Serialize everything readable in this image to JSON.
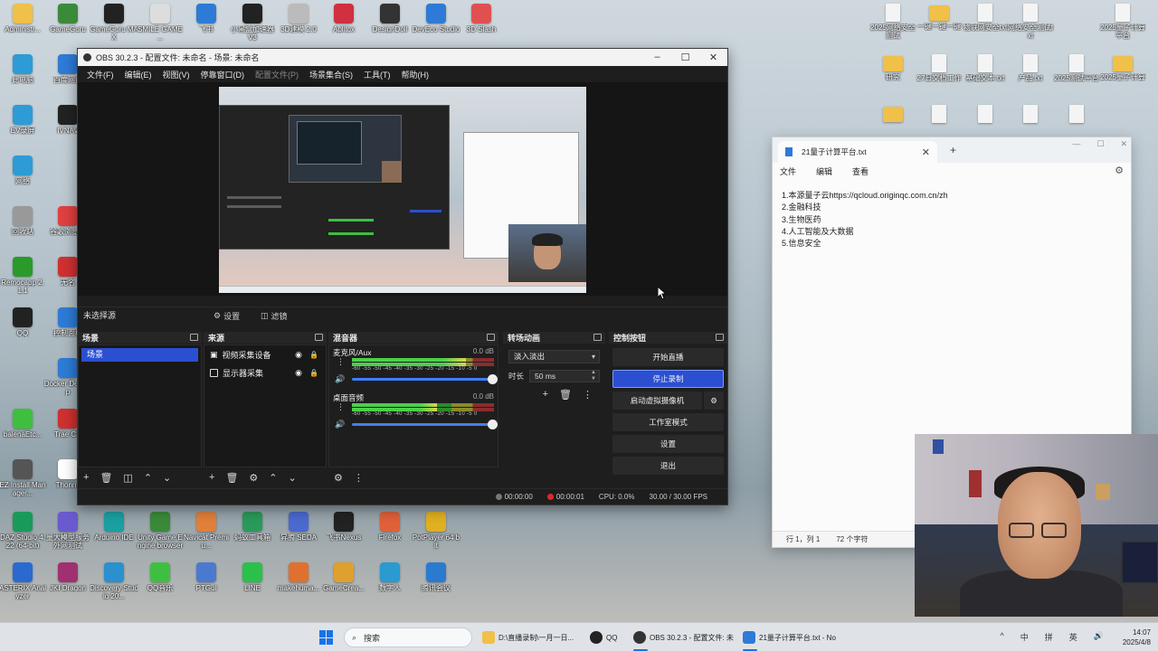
{
  "desktop": {
    "left_icons": [
      {
        "label": "Administr...",
        "color": "#f0c048"
      },
      {
        "label": "GameGuru",
        "color": "#3a8a3a"
      },
      {
        "label": "GameGuru MAX",
        "color": "#222222"
      },
      {
        "label": "SMILE GAME ...",
        "color": "#dddddd"
      },
      {
        "label": "飞书",
        "color": "#2d7bd6"
      },
      {
        "label": "小黑盒加速器 V3",
        "color": "#222222"
      },
      {
        "label": "3D建模 2.0",
        "color": "#bbbbbb"
      },
      {
        "label": "Aplitox",
        "color": "#d03040"
      },
      {
        "label": "DesignDoll",
        "color": "#333333"
      },
      {
        "label": "DevEco Studio",
        "color": "#2d7bd6"
      },
      {
        "label": "3D Slash",
        "color": "#e05050"
      },
      {
        "label": "此电脑",
        "color": "#2d9bd6"
      },
      {
        "label": "百度网盘",
        "color": "#2d7bd6"
      },
      {
        "label": "IVNAV",
        "color": "#222222"
      },
      {
        "label": "EV录屏",
        "color": "#2d9bd6"
      },
      {
        "label": "网络",
        "color": "#2d9bd6"
      },
      {
        "label": "回收站",
        "color": "#999999"
      },
      {
        "label": "谷歌浏览器",
        "color": "#e04040"
      },
      {
        "label": "Remocapp 2.1.1",
        "color": "#2a9a2a"
      },
      {
        "label": "无名",
        "color": "#d03030"
      },
      {
        "label": "QQ",
        "color": "#222222"
      },
      {
        "label": "控制面板",
        "color": "#2d7bd6"
      },
      {
        "label": "Docker Desktop",
        "color": "#2d7bd6"
      },
      {
        "label": "balenaEtc...",
        "color": "#3fbf3f"
      },
      {
        "label": "Trae CN",
        "color": "#d03030"
      },
      {
        "label": "EZ Install Manager...",
        "color": "#555555"
      },
      {
        "label": "Thonny",
        "color": "#ffffff"
      }
    ],
    "bottom_icons": [
      {
        "label": "DAZ Studio 4.22 (64-bit)",
        "color": "#1a9a5a"
      },
      {
        "label": "量大模型服务 外网测试",
        "color": "#6a5acd"
      },
      {
        "label": "Arduino IDE",
        "color": "#1aa0a0"
      },
      {
        "label": "Unity Game Engine browser 2",
        "color": "#3a8a3a"
      },
      {
        "label": "Navicat Premiu...",
        "color": "#e0803a"
      },
      {
        "label": "蚂蚁工具箱",
        "color": "#2a9a5a"
      },
      {
        "label": "昇腾 SEDA",
        "color": "#4a6ad0"
      },
      {
        "label": "飞书Nexus",
        "color": "#222222"
      },
      {
        "label": "Firefox",
        "color": "#e0603a"
      },
      {
        "label": "PotPlayer 64 bit",
        "color": "#e0b020"
      },
      {
        "label": "ASTERIX Analyzer",
        "color": "#2a6ad0"
      },
      {
        "label": "JKI Dragon",
        "color": "#a03070"
      },
      {
        "label": "Discovery Studio 20...",
        "color": "#2a90d0"
      },
      {
        "label": "QQ音乐",
        "color": "#3fbf3f"
      },
      {
        "label": "PTGui",
        "color": "#4a7ad0"
      },
      {
        "label": "LINE",
        "color": "#2ac04a"
      },
      {
        "label": "makehuma...",
        "color": "#e07030"
      },
      {
        "label": "GameCrea...",
        "color": "#e0a030"
      },
      {
        "label": "数字人",
        "color": "#2a9ad0"
      },
      {
        "label": "腾讯会议",
        "color": "#2a7ad0"
      }
    ],
    "right_icons": [
      {
        "label": "2025网络安全测试"
      },
      {
        "label": "一键一键一键",
        "type": "folder"
      },
      {
        "label": "物联网安全txt"
      },
      {
        "label": "网络安全测试txt"
      },
      {
        "label": "2025量子计算平台"
      },
      {
        "label": "研究",
        "type": "folder"
      },
      {
        "label": "27日文档工作"
      },
      {
        "label": "基础文本.txt"
      },
      {
        "label": "产品.txt"
      },
      {
        "label": "2025测试平台"
      },
      {
        "label": "2025量子计算",
        "type": "folder"
      },
      {
        "label": "",
        "type": "folder"
      },
      {
        "label": ""
      },
      {
        "label": ""
      },
      {
        "label": ""
      },
      {
        "label": ""
      }
    ]
  },
  "obs": {
    "title": "OBS 30.2.3 - 配置文件: 未命名 - 场景: 未命名",
    "menu": [
      "文件(F)",
      "编辑(E)",
      "视图(V)",
      "停靠窗口(D)",
      "配置文件(P)",
      "场景集合(S)",
      "工具(T)",
      "帮助(H)"
    ],
    "no_source_selected": "未选择源",
    "properties_label": "设置",
    "filters_label": "滤镜",
    "docks": {
      "scenes": {
        "title": "场景",
        "items": [
          "场景"
        ]
      },
      "sources": {
        "title": "来源",
        "items": [
          "视频采集设备",
          "显示器采集"
        ]
      },
      "mixer": {
        "title": "混音器",
        "channels": [
          {
            "name": "麦克风/Aux",
            "db": "0.0 dB",
            "level": 0.8
          },
          {
            "name": "桌面音频",
            "db": "0.0 dB",
            "level": 0.6
          }
        ],
        "scale": "-60 -55 -50 -45 -40 -35 -30 -25 -20 -15 -10 -5 0"
      },
      "transitions": {
        "title": "转场动画",
        "selected": "淡入淡出",
        "duration_label": "时长",
        "duration_value": "50 ms"
      },
      "controls": {
        "title": "控制按钮",
        "start_stream": "开始直播",
        "stop_record": "停止录制",
        "virtual_cam": "启动虚拟摄像机",
        "studio_mode": "工作室模式",
        "settings": "设置",
        "exit": "退出"
      }
    },
    "status": {
      "stream_time": "00:00:00",
      "record_time": "00:00:01",
      "cpu": "CPU: 0.0%",
      "fps": "30.00 / 30.00 FPS"
    }
  },
  "notepad": {
    "tab_title": "21量子计算平台.txt",
    "menu": [
      "文件",
      "编辑",
      "查看"
    ],
    "lines": [
      "1.本源量子云https://qcloud.originqc.com.cn/zh",
      "2.金融科技",
      "3.生物医药",
      "4.人工智能及大数据",
      "5.信息安全"
    ],
    "status_pos": "行 1，列 1",
    "status_chars": "72 个字符"
  },
  "taskbar": {
    "search_placeholder": "搜索",
    "apps": [
      {
        "label": "D:\\直播录制\\一月一日...",
        "color": "#f0c048"
      },
      {
        "label": "QQ",
        "color": "#222222"
      },
      {
        "label": "OBS 30.2.3 - 配置文件: 未",
        "color": "#333333"
      },
      {
        "label": "21量子计算平台.txt - No",
        "color": "#2d7bd6"
      }
    ],
    "tray": [
      "^",
      "中",
      "拼",
      "英",
      "🔊"
    ],
    "time": "14:07",
    "date": "2025/4/8"
  }
}
